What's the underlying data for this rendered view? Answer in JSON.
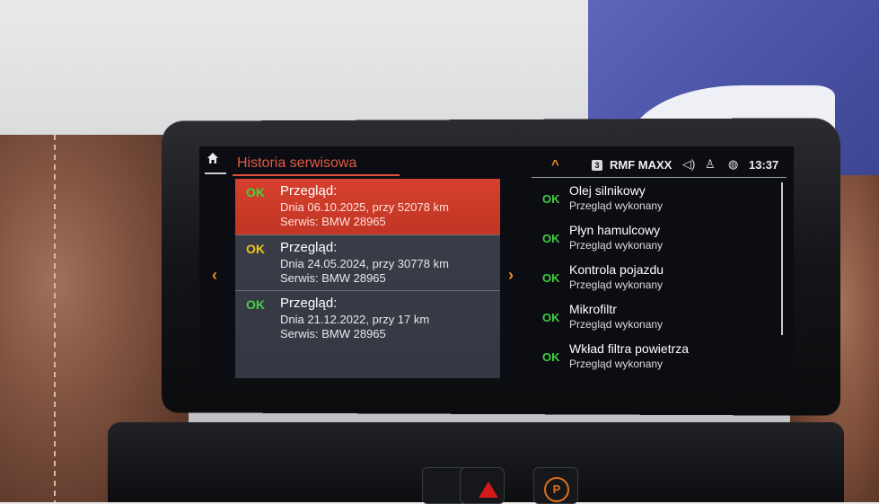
{
  "header": {
    "title": "Historia serwisowa"
  },
  "history": [
    {
      "status": "OK",
      "status_color": "#42d142",
      "heading": "Przegląd:",
      "line1": "Dnia 06.10.2025, przy 52078 km",
      "line2": "Serwis: BMW 28965",
      "selected": true
    },
    {
      "status": "OK",
      "status_color": "#f0c419",
      "heading": "Przegląd:",
      "line1": "Dnia 24.05.2024, przy 30778 km",
      "line2": "Serwis: BMW 28965",
      "selected": false
    },
    {
      "status": "OK",
      "status_color": "#42d142",
      "heading": "Przegląd:",
      "line1": "Dnia 21.12.2022, przy 17 km",
      "line2": "Serwis: BMW 28965",
      "selected": false
    }
  ],
  "statusbar": {
    "radio_preset": "3",
    "station": "RMF MAXX",
    "time": "13:37",
    "icons": [
      "chevron-up-icon",
      "volume-icon",
      "user-icon",
      "globe-icon"
    ]
  },
  "checks": [
    {
      "status": "OK",
      "name": "Olej silnikowy",
      "sub": "Przegląd wykonany"
    },
    {
      "status": "OK",
      "name": "Płyn hamulcowy",
      "sub": "Przegląd wykonany"
    },
    {
      "status": "OK",
      "name": "Kontrola pojazdu",
      "sub": "Przegląd wykonany"
    },
    {
      "status": "OK",
      "name": "Mikrofiltr",
      "sub": "Przegląd wykonany"
    },
    {
      "status": "OK",
      "name": "Wkład filtra powietrza",
      "sub": "Przegląd wykonany"
    }
  ],
  "colors": {
    "accent": "#e35a44",
    "selected_bg": "#c9392a",
    "ok_green": "#3ecf3e",
    "ok_yellow": "#f0c419",
    "arrow_orange": "#f08a2a"
  }
}
